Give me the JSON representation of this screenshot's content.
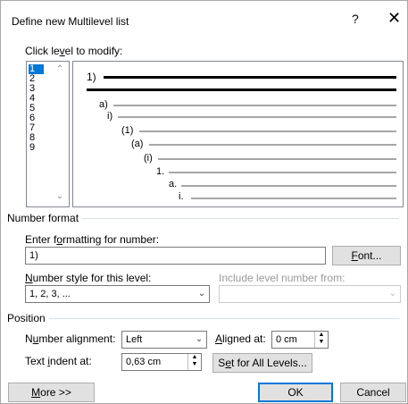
{
  "dialog": {
    "title": "Define new Multilevel list",
    "help_glyph": "?",
    "close_glyph": "✕"
  },
  "levels_section": {
    "label_pre": "Click le",
    "label_ul": "v",
    "label_post": "el to modify:",
    "items": [
      "1",
      "2",
      "3",
      "4",
      "5",
      "6",
      "7",
      "8",
      "9"
    ],
    "selected": "1"
  },
  "preview": {
    "labels": [
      "1)",
      "a)",
      "i)",
      "(1)",
      "(a)",
      "(i)",
      "1.",
      "a.",
      "i."
    ]
  },
  "number_format": {
    "group_title": "Number format",
    "enter_label_pre": "Enter f",
    "enter_label_ul": "o",
    "enter_label_post": "rmatting for number:",
    "format_value": "1)",
    "font_button_ul": "F",
    "font_button_post": "ont...",
    "style_label_ul": "N",
    "style_label_post": "umber style for this level:",
    "style_value": "1, 2, 3, ...",
    "include_label": "Include level number from:",
    "include_value": ""
  },
  "position": {
    "group_title": "Position",
    "alignment_label_pre": "N",
    "alignment_label_ul": "u",
    "alignment_label_post": "mber alignment:",
    "alignment_value": "Left",
    "aligned_at_label_ul": "A",
    "aligned_at_label_post": "ligned at:",
    "aligned_at_value": "0 cm",
    "text_indent_label_pre": "Text ",
    "text_indent_label_ul": "i",
    "text_indent_label_post": "ndent at:",
    "text_indent_value": "0,63 cm",
    "set_all_button_pre": "S",
    "set_all_button_ul": "e",
    "set_all_button_post": "t for All Levels..."
  },
  "footer": {
    "more_button_ul": "M",
    "more_button_post": "ore >>",
    "ok_button": "OK",
    "cancel_button": "Cancel"
  }
}
